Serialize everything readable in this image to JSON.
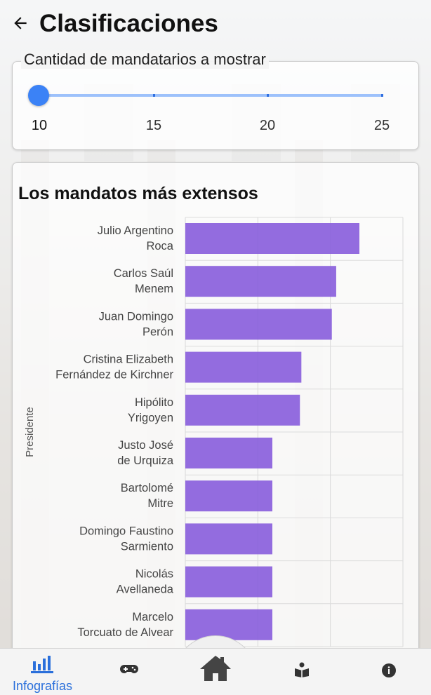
{
  "header": {
    "title": "Clasificaciones",
    "back_icon": "arrow-left-icon"
  },
  "slider": {
    "label": "Cantidad de mandatarios a mostrar",
    "value": 10,
    "min": 10,
    "max": 25,
    "tick_labels": [
      "10",
      "15",
      "20",
      "25"
    ],
    "accent": "#3b82f6"
  },
  "chart_data": {
    "type": "bar",
    "orientation": "horizontal",
    "title": "Los mandatos más extensos",
    "ylabel": "Presidente",
    "categories": [
      "Julio Argentino Roca",
      "Carlos Saúl Menem",
      "Juan Domingo Perón",
      "Cristina Elizabeth Fernández de Kirchner",
      "Hipólito Yrigoyen",
      "Justo José de Urquiza",
      "Bartolomé Mitre",
      "Domingo Faustino Sarmiento",
      "Nicolás Avellaneda",
      "Marcelo Torcuato de Alvear"
    ],
    "category_lines": [
      [
        "Julio Argentino",
        "Roca"
      ],
      [
        "Carlos Saúl",
        "Menem"
      ],
      [
        "Juan Domingo",
        "Perón"
      ],
      [
        "Cristina Elizabeth",
        "Fernández de Kirchner"
      ],
      [
        "Hipólito",
        "Yrigoyen"
      ],
      [
        "Justo José",
        "de Urquiza"
      ],
      [
        "Bartolomé",
        "Mitre"
      ],
      [
        "Domingo Faustino",
        "Sarmiento"
      ],
      [
        "Nicolás",
        "Avellaneda"
      ],
      [
        "Marcelo",
        "Torcuato de Alvear"
      ]
    ],
    "values": [
      12,
      10.4,
      10.1,
      8,
      7.9,
      6,
      6,
      6,
      6,
      6
    ],
    "xlim": [
      0,
      15
    ],
    "grid": true,
    "bar_color": "#8a5fdc"
  },
  "bottom_nav": {
    "items": [
      {
        "icon": "bar-chart-icon",
        "label": "Infografías",
        "active": true
      },
      {
        "icon": "gamepad-icon",
        "label": ""
      },
      {
        "icon": "home-icon",
        "label": ""
      },
      {
        "icon": "reading-icon",
        "label": ""
      },
      {
        "icon": "info-icon",
        "label": ""
      }
    ],
    "accent": "#2a6fdb"
  }
}
